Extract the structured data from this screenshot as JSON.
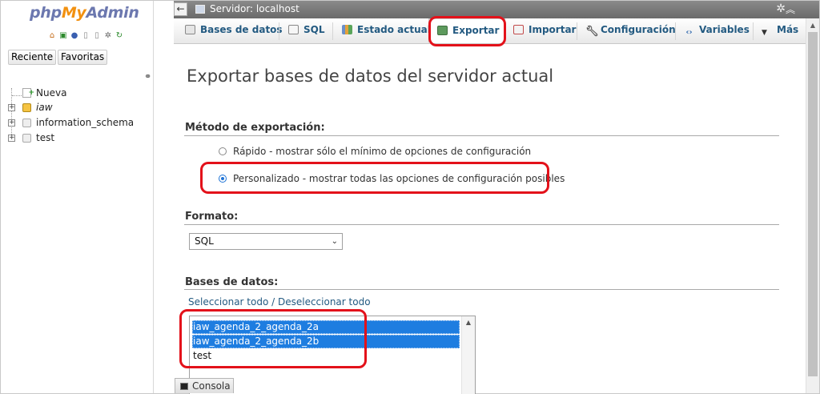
{
  "app": {
    "logo_php": "php",
    "logo_my": "My",
    "logo_admin": "Admin"
  },
  "nav": {
    "recent_label": "Reciente",
    "favorites_label": "Favoritas",
    "tree": [
      {
        "label": "Nueva",
        "italic": false
      },
      {
        "label": "iaw",
        "italic": true
      },
      {
        "label": "information_schema",
        "italic": false
      },
      {
        "label": "test",
        "italic": false
      }
    ]
  },
  "server_bar": {
    "title": "Servidor: localhost"
  },
  "tabs": [
    {
      "label": "Bases de datos",
      "icon": "database-icon"
    },
    {
      "label": "SQL",
      "icon": "sql-icon"
    },
    {
      "label": "Estado actual",
      "icon": "status-icon"
    },
    {
      "label": "Exportar",
      "icon": "export-icon",
      "active": true
    },
    {
      "label": "Importar",
      "icon": "import-icon"
    },
    {
      "label": "Configuración",
      "icon": "wrench-icon"
    },
    {
      "label": "Variables",
      "icon": "variables-icon"
    },
    {
      "label": "Más",
      "icon": "caret-down-icon"
    }
  ],
  "main": {
    "heading": "Exportar bases de datos del servidor actual",
    "method_title": "Método de exportación:",
    "method_quick": "Rápido - mostrar sólo el mínimo de opciones de configuración",
    "method_custom": "Personalizado - mostrar todas las opciones de configuración posibles",
    "format_title": "Formato:",
    "format_value": "SQL",
    "databases_title": "Bases de datos:",
    "select_all": "Seleccionar todo / Deseleccionar todo",
    "databases": [
      {
        "label": "iaw_agenda_2_agenda_2a",
        "selected": true
      },
      {
        "label": "iaw_agenda_2_agenda_2b",
        "selected": true
      },
      {
        "label": "test",
        "selected": false
      }
    ]
  },
  "console": {
    "label": "Consola"
  },
  "colors": {
    "link": "#235a81",
    "highlight": "#e3111a",
    "selection": "#1e7de0"
  }
}
